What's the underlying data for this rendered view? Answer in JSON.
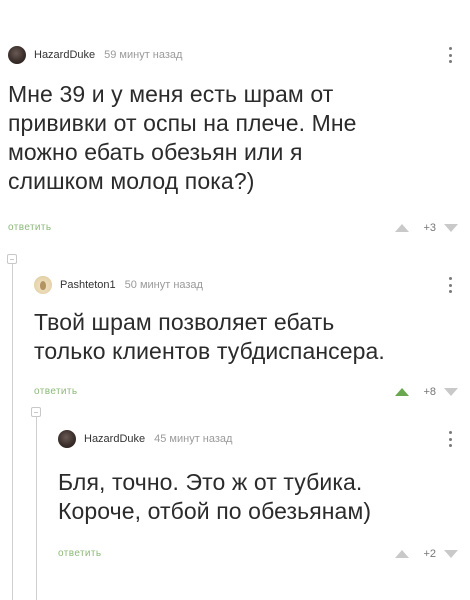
{
  "comments": [
    {
      "username": "HazardDuke",
      "time": "59 минут назад",
      "text_lines": [
        "Мне 39 и у меня есть шрам от",
        "прививки от оспы на плече. Мне",
        "можно ебать обезьян или я",
        "слишком молод пока?)"
      ],
      "reply_label": "ответить",
      "score": "+3",
      "upvoted": false
    },
    {
      "username": "Pashteton1",
      "time": "50 минут назад",
      "text_lines": [
        "Твой шрам позволяет ебать",
        "только клиентов тубдиспансера."
      ],
      "reply_label": "ответить",
      "score": "+8",
      "upvoted": true
    },
    {
      "username": "HazardDuke",
      "time": "45 минут назад",
      "text_lines": [
        "Бля, точно. Это ж от тубика.",
        "Короче, отбой по обезьянам)"
      ],
      "reply_label": "ответить",
      "score": "+2",
      "upvoted": false
    }
  ],
  "colors": {
    "reply": "#8cb87a",
    "upvote_active": "#6aa84f",
    "vote_inactive": "#c9c9c9"
  }
}
